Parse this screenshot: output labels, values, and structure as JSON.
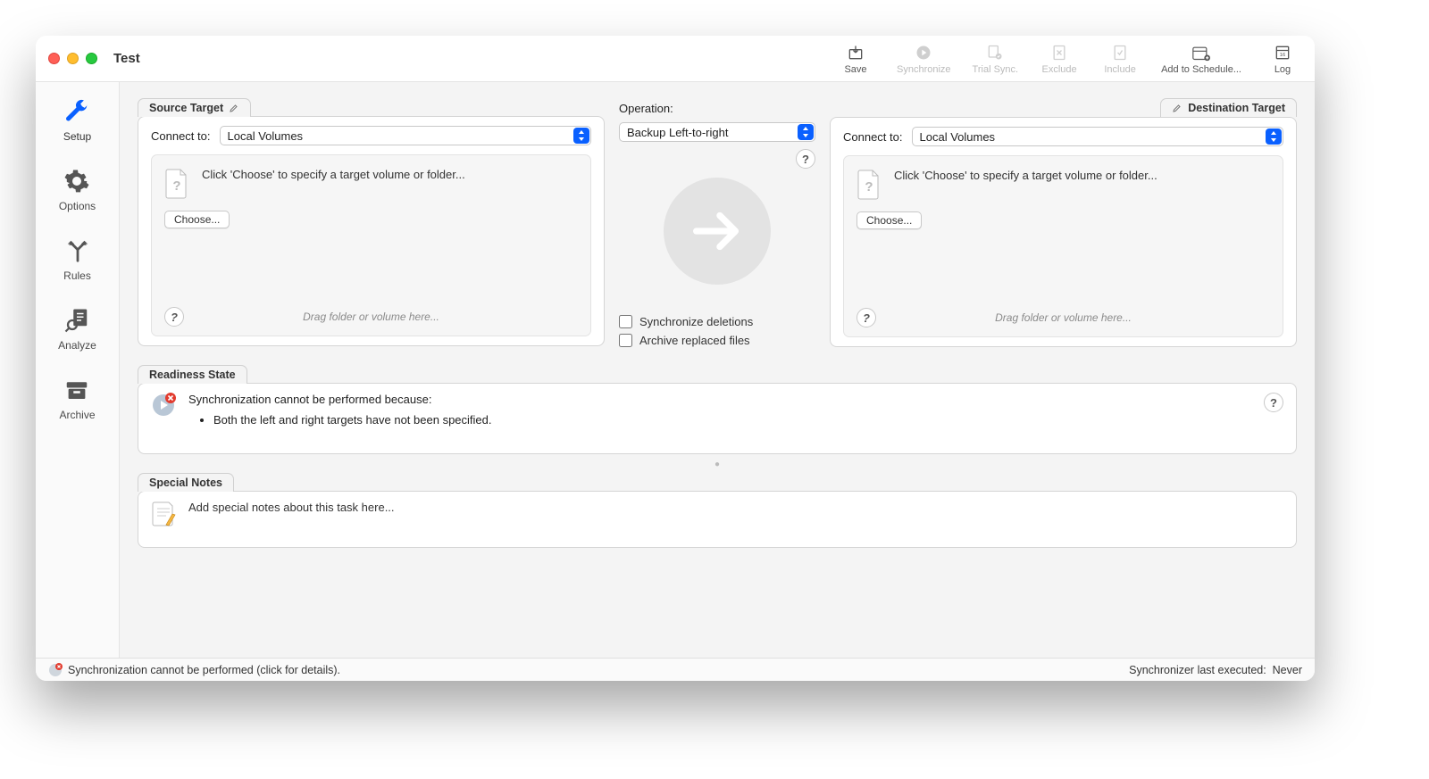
{
  "window": {
    "title": "Test"
  },
  "toolbar": {
    "save": "Save",
    "synchronize": "Synchronize",
    "trial_sync": "Trial Sync.",
    "exclude": "Exclude",
    "include": "Include",
    "add_schedule": "Add to Schedule...",
    "log": "Log"
  },
  "sidebar": {
    "setup": "Setup",
    "options": "Options",
    "rules": "Rules",
    "analyze": "Analyze",
    "archive": "Archive"
  },
  "source": {
    "tab": "Source Target",
    "connect_label": "Connect to:",
    "connect_value": "Local Volumes",
    "hint": "Click 'Choose' to specify a target volume or folder...",
    "choose": "Choose...",
    "drag_hint": "Drag folder or volume here..."
  },
  "operation": {
    "label": "Operation:",
    "value": "Backup Left-to-right",
    "sync_deletions": "Synchronize deletions",
    "archive_replaced": "Archive replaced files"
  },
  "destination": {
    "tab": "Destination Target",
    "connect_label": "Connect to:",
    "connect_value": "Local Volumes",
    "hint": "Click 'Choose' to specify a target volume or folder...",
    "choose": "Choose...",
    "drag_hint": "Drag folder or volume here..."
  },
  "readiness": {
    "tab": "Readiness State",
    "message": "Synchronization cannot be performed because:",
    "bullet": "Both the left and right targets have not been specified."
  },
  "notes": {
    "tab": "Special Notes",
    "placeholder": "Add special notes about this task here..."
  },
  "status": {
    "left": "Synchronization cannot be performed (click for details).",
    "right_label": "Synchronizer last executed:",
    "right_value": "Never"
  }
}
